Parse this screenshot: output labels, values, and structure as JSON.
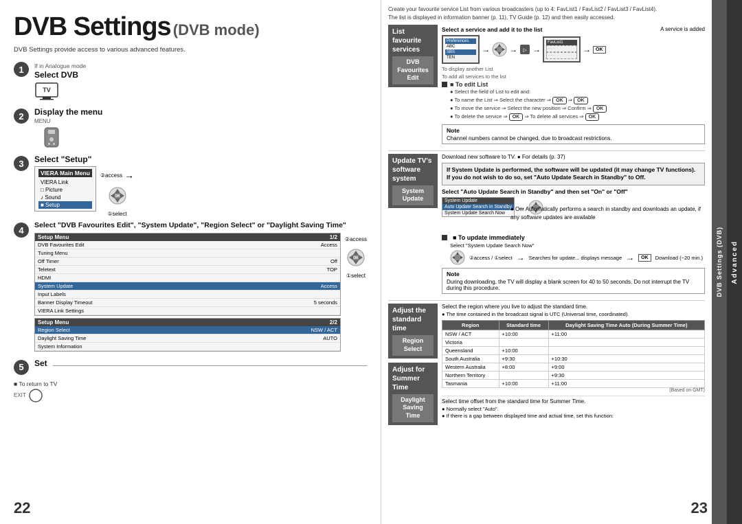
{
  "left": {
    "title": "DVB Settings",
    "subtitle": " (DVB mode)",
    "intro": "DVB Settings provide access to various advanced features.",
    "analogue_note": "If in Analogue mode",
    "steps": [
      {
        "num": "1",
        "label": "Select DVB"
      },
      {
        "num": "2",
        "label": "Display the menu",
        "sublabel": "MENU"
      },
      {
        "num": "3",
        "label": "Select \"Setup\"",
        "access": "②access",
        "select": "①select"
      },
      {
        "num": "4",
        "label": "Select \"DVB Favourites Edit\", \"System Update\", \"Region Select\" or \"Daylight Saving Time\"",
        "access": "②access",
        "select": "①select"
      },
      {
        "num": "5",
        "label": "Set"
      }
    ],
    "return_to_tv": "■ To return to TV",
    "exit_label": "EXIT",
    "page_number": "22",
    "menu_items_3": [
      {
        "label": "VIERA Main Menu",
        "value": ""
      },
      {
        "label": "VIERA Link",
        "value": ""
      },
      {
        "label": "□ Picture",
        "value": ""
      },
      {
        "label": "♪ Sound",
        "value": ""
      },
      {
        "label": "■ Setup",
        "value": "",
        "selected": true
      }
    ],
    "setup_menu_items": [
      {
        "label": "DVB Favourites Edit",
        "value": "Access"
      },
      {
        "label": "Tuning Menu",
        "value": ""
      },
      {
        "label": "Off Timer",
        "value": "Off"
      },
      {
        "label": "Teletext",
        "value": "TOP"
      },
      {
        "label": "HDMI",
        "value": ""
      },
      {
        "label": "System Update",
        "value": "Access",
        "selected": true
      },
      {
        "label": "Input Labels",
        "value": ""
      },
      {
        "label": "Banner Display Timeout",
        "value": "5 seconds"
      },
      {
        "label": "VIERA Link Settings",
        "value": ""
      }
    ],
    "setup_menu2_items": [
      {
        "label": "Region Select",
        "value": "NSW / ACT",
        "selected": true
      },
      {
        "label": "Daylight Saving Time",
        "value": "AUTO"
      },
      {
        "label": "System Information",
        "value": ""
      }
    ]
  },
  "right": {
    "page_number": "23",
    "top_text": "Create your favourite service List from various broadcasters (up to 4: FavList1 / FavList2 / FavList3 / FavList4).\nThe list is displayed in information banner (p. 11), TV Guide (p. 12) and then easily accessed.",
    "section1": {
      "title": "List favourite services",
      "sublabel": "DVB Favourites Edit",
      "select_label": "Select a service and add it to the list",
      "service_added": "A service is added",
      "to_display": "To display another List",
      "to_add_all": "To add all services to the list",
      "to_edit_title": "■ To edit List",
      "to_edit_items": [
        "Select the field of List to edit and:",
        "To name the List ⇒ Select the character ⇒ OK ⇒ OK",
        "To move the service ⇒ Select the new position ⇒ Confirm ⇒ OK",
        "To delete the service ⇒ OK ⇒ To delete all services ⇒ OK"
      ],
      "note_title": "Note",
      "note_text": "Channel numbers cannot be changed, due to broadcast restrictions."
    },
    "section2": {
      "title": "Update TV's software system",
      "sublabel": "System Update",
      "download_note": "Download new software to TV.",
      "for_details": "● For details (p. 37)",
      "bold_warning": "If System Update is performed, the software will be updated (it may change TV functions). If you do not wish to do so, set \"Auto Update Search in Standby\" to Off.",
      "auto_update_label": "Select \"Auto Update Search in Standby\" and then set \"On\" or \"Off\"",
      "on_description": "● On: Automatically performs a search in standby and downloads an update, if any software updates are available",
      "to_update_title": "■ To update immediately",
      "to_update_steps": [
        "Select \"System Update Search Now\"",
        "②access",
        "①select",
        "Searches for an update (for several min.) and displays a corresponding message if any",
        "Download",
        "● Download may take for about 20 min."
      ],
      "note2_title": "Note",
      "note2_text": "During downloading, the TV will display a blank screen for 40 to 50 seconds. Do not interrupt the TV during this procedure."
    },
    "section3": {
      "title": "Adjust the standard time",
      "sublabel": "Region Select",
      "description": "Select the region where you live to adjust the standard time.",
      "bullet1": "● The time contained in the broadcast signal is UTC (Universal time, coordinated).",
      "table_headers": [
        "Region",
        "Standard time",
        "Daylight Saving Time Auto (During Summer Time)"
      ],
      "table_rows": [
        {
          "region": "NSW / ACT",
          "std": "+10:00",
          "dst": "+11:00"
        },
        {
          "region": "Victoria",
          "std": "",
          "dst": ""
        },
        {
          "region": "Queensland",
          "std": "+10:00",
          "dst": ""
        },
        {
          "region": "South Australia",
          "std": "+9:30",
          "dst": "+10:30"
        },
        {
          "region": "Western Australia",
          "std": "+8:00",
          "dst": "+9:00"
        },
        {
          "region": "Northern Territory",
          "std": "",
          "dst": "+9:30"
        },
        {
          "region": "Tasmania",
          "std": "+10:00",
          "dst": "+11:00"
        }
      ],
      "based_on_gmt": "(Based on GMT)"
    },
    "section4": {
      "title": "Adjust for Summer Time",
      "sublabel": "Daylight Saving Time",
      "description": "Select time offset from the standard time for Summer Time.",
      "bullet1": "● Normally select \"Auto\".",
      "bullet2": "● If there is a gap between displayed time and actual time, set this function:"
    },
    "sidebar_dvb": "DVB Settings (DVB)",
    "sidebar_advanced": "Advanced"
  }
}
